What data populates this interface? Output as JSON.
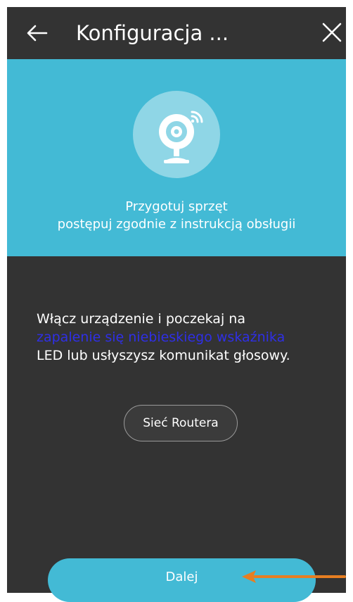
{
  "header": {
    "title": "Konfiguracja ...",
    "back_icon": "arrow-left-icon",
    "close_icon": "close-icon"
  },
  "banner": {
    "icon": "webcam-wifi-icon",
    "line1": "Przygotuj sprzęt",
    "line2": "postępuj zgodnie z instrukcją obsługii"
  },
  "instruction": {
    "line1": "Włącz urządzenie i poczekaj na",
    "line2_highlight": "zapalenie się niebieskiego wskaźnika",
    "line3": "LED lub usłyszysz komunikat głosowy."
  },
  "buttons": {
    "router": "Sieć Routera",
    "next": "Dalej"
  },
  "annotation": {
    "icon": "orange-arrow-icon"
  },
  "colors": {
    "accent": "#43bad5",
    "background": "#333333",
    "highlight_text": "#2f2fe6",
    "annotation_arrow": "#e67e22"
  }
}
